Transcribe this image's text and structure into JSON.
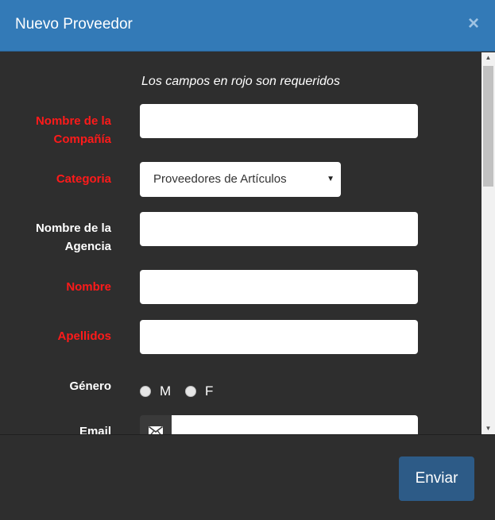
{
  "modal": {
    "title": "Nuevo Proveedor",
    "close_glyph": "×"
  },
  "form": {
    "hint": "Los campos en rojo son requeridos",
    "company_name_label_line1": "Nombre de la",
    "company_name_label_line2": "Compañía",
    "category_label": "Categoria",
    "category_selected": "Proveedores de Artículos",
    "agency_name_label_line1": "Nombre de la",
    "agency_name_label_line2": "Agencia",
    "first_name_label": "Nombre",
    "last_name_label": "Apellidos",
    "gender_label": "Género",
    "gender_option_m": "M",
    "gender_option_f": "F",
    "email_label": "Email"
  },
  "footer": {
    "submit_label": "Enviar"
  },
  "colors": {
    "header": "#337ab7",
    "body": "#2e2e2e",
    "required_label": "#ff1a1a",
    "submit": "#2d5b87"
  }
}
